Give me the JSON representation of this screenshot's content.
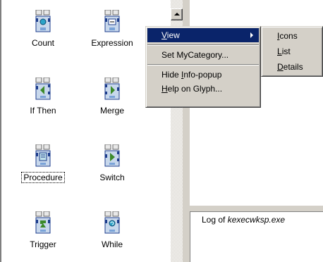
{
  "palette": {
    "glyphs": [
      {
        "label": "Count",
        "icon": "count-glyph-icon"
      },
      {
        "label": "Expression",
        "icon": "expression-glyph-icon"
      },
      {
        "label": "If Then",
        "icon": "if-then-glyph-icon"
      },
      {
        "label": "Merge",
        "icon": "merge-glyph-icon"
      },
      {
        "label": "Procedure",
        "icon": "procedure-glyph-icon",
        "focused": true
      },
      {
        "label": "Switch",
        "icon": "switch-glyph-icon"
      },
      {
        "label": "Trigger",
        "icon": "trigger-glyph-icon"
      },
      {
        "label": "While",
        "icon": "while-glyph-icon"
      }
    ]
  },
  "context_menu": {
    "view": {
      "pre": "",
      "acc": "V",
      "post": "iew"
    },
    "set_category": {
      "pre": "Set MyCategory...",
      "acc": "",
      "post": ""
    },
    "hide_info": {
      "pre": "Hide ",
      "acc": "I",
      "post": "nfo-popup"
    },
    "help_glyph": {
      "pre": "",
      "acc": "H",
      "post": "elp on Glyph..."
    }
  },
  "submenu": {
    "icons": {
      "pre": "",
      "acc": "I",
      "post": "cons"
    },
    "list": {
      "pre": "",
      "acc": "L",
      "post": "ist"
    },
    "details": {
      "pre": "",
      "acc": "D",
      "post": "etails"
    }
  },
  "log_pane": {
    "title_prefix": "Log of ",
    "title_file": "kexecwksp.exe"
  },
  "colors": {
    "menu_highlight": "#0a246a",
    "menu_face": "#d4d0c8",
    "glyph_blue": "#3a6fd8",
    "glyph_green": "#5aa04a"
  }
}
